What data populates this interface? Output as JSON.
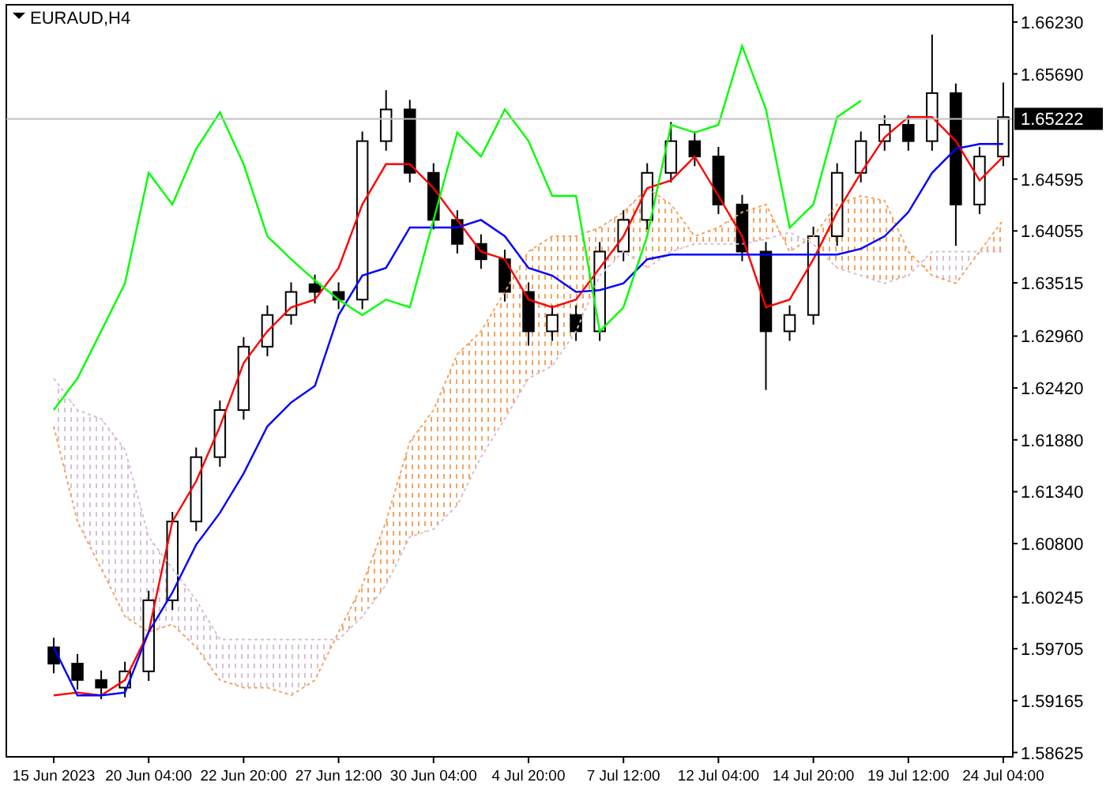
{
  "chart": {
    "title": "EURAUD,H4",
    "chart_data": {
      "type": "candlestick",
      "categories": [
        "15 Jun 2023",
        null,
        null,
        null,
        "20 Jun 04:00",
        null,
        null,
        null,
        "22 Jun 20:00",
        null,
        null,
        null,
        "27 Jun 12:00",
        null,
        null,
        null,
        "30 Jun 04:00",
        null,
        null,
        null,
        "4 Jul 20:00",
        null,
        null,
        null,
        "7 Jul 12:00",
        null,
        null,
        null,
        "12 Jul 04:00",
        null,
        null,
        null,
        "14 Jul 20:00",
        null,
        null,
        null,
        "19 Jul 12:00",
        null,
        null,
        null,
        "24 Jul 04:00"
      ],
      "ylim": [
        1.5858,
        1.6641
      ],
      "yticks": [
        {
          "value": 1.6623,
          "label": "1.66230"
        },
        {
          "value": 1.6569,
          "label": "1.65690"
        },
        {
          "value": 1.64595,
          "label": "1.64595"
        },
        {
          "value": 1.64055,
          "label": "1.64055"
        },
        {
          "value": 1.63515,
          "label": "1.63515"
        },
        {
          "value": 1.6296,
          "label": "1.62960"
        },
        {
          "value": 1.6242,
          "label": "1.62420"
        },
        {
          "value": 1.6188,
          "label": "1.61880"
        },
        {
          "value": 1.6134,
          "label": "1.61340"
        },
        {
          "value": 1.608,
          "label": "1.60800"
        },
        {
          "value": 1.60245,
          "label": "1.60245"
        },
        {
          "value": 1.59705,
          "label": "1.59705"
        },
        {
          "value": 1.59165,
          "label": "1.59165"
        },
        {
          "value": 1.58625,
          "label": "1.58625"
        }
      ],
      "ohlc": [
        [
          1.5972,
          1.5982,
          1.5945,
          1.5955
        ],
        [
          1.5955,
          1.5965,
          1.5928,
          1.5938
        ],
        [
          1.5938,
          1.5948,
          1.5918,
          1.593
        ],
        [
          1.593,
          1.5957,
          1.592,
          1.5947
        ],
        [
          1.5947,
          1.6031,
          1.5937,
          1.6021
        ],
        [
          1.6021,
          1.6113,
          1.6011,
          1.6103
        ],
        [
          1.6103,
          1.618,
          1.6093,
          1.617
        ],
        [
          1.617,
          1.6229,
          1.616,
          1.6219
        ],
        [
          1.6219,
          1.6295,
          1.6209,
          1.6285
        ],
        [
          1.6285,
          1.6328,
          1.6275,
          1.6318
        ],
        [
          1.6318,
          1.6352,
          1.6308,
          1.6342
        ],
        [
          1.635,
          1.636,
          1.633,
          1.6342
        ],
        [
          1.6342,
          1.6352,
          1.6324,
          1.6334
        ],
        [
          1.6334,
          1.6509,
          1.6324,
          1.6499
        ],
        [
          1.6499,
          1.6552,
          1.6489,
          1.6532
        ],
        [
          1.6532,
          1.6542,
          1.6456,
          1.6466
        ],
        [
          1.6466,
          1.6476,
          1.6407,
          1.6417
        ],
        [
          1.6417,
          1.6427,
          1.6382,
          1.6392
        ],
        [
          1.6392,
          1.6402,
          1.6366,
          1.6376
        ],
        [
          1.6376,
          1.6386,
          1.6332,
          1.6342
        ],
        [
          1.6342,
          1.6352,
          1.6286,
          1.6301
        ],
        [
          1.6301,
          1.6328,
          1.6291,
          1.6318
        ],
        [
          1.6318,
          1.6328,
          1.6291,
          1.6301
        ],
        [
          1.6301,
          1.6394,
          1.6291,
          1.6384
        ],
        [
          1.6384,
          1.6427,
          1.6374,
          1.6417
        ],
        [
          1.6417,
          1.6476,
          1.6407,
          1.6466
        ],
        [
          1.6466,
          1.6519,
          1.6456,
          1.6499
        ],
        [
          1.6499,
          1.6509,
          1.6473,
          1.6483
        ],
        [
          1.6483,
          1.6493,
          1.6423,
          1.6433
        ],
        [
          1.6433,
          1.6443,
          1.6374,
          1.6384
        ],
        [
          1.6384,
          1.6394,
          1.624,
          1.6301
        ],
        [
          1.6301,
          1.6328,
          1.6291,
          1.6318
        ],
        [
          1.6318,
          1.641,
          1.6308,
          1.64
        ],
        [
          1.64,
          1.6476,
          1.639,
          1.6466
        ],
        [
          1.6466,
          1.6509,
          1.6456,
          1.6499
        ],
        [
          1.6499,
          1.6526,
          1.6489,
          1.6516
        ],
        [
          1.6516,
          1.6526,
          1.6489,
          1.6499
        ],
        [
          1.6499,
          1.661,
          1.6489,
          1.6549
        ],
        [
          1.6549,
          1.6559,
          1.639,
          1.6433
        ],
        [
          1.6433,
          1.6493,
          1.6423,
          1.6483
        ],
        [
          1.6483,
          1.656,
          1.6473,
          1.6524
        ]
      ],
      "series": [
        {
          "type": "line",
          "line_style": "dashed",
          "color": "#f4a460",
          "values": [
            1.6202,
            1.6103,
            1.6054,
            1.6004,
            1.5988,
            1.5996,
            1.5972,
            1.5938,
            1.593,
            1.593,
            1.5922,
            1.5938,
            1.5988,
            1.6037,
            1.6103,
            1.6186,
            1.6219,
            1.6277,
            1.6301,
            1.6342,
            1.6384,
            1.64,
            1.64,
            1.6409,
            1.6425,
            1.645,
            1.6433,
            1.64,
            1.6409,
            1.6425,
            1.6433,
            1.6384,
            1.64,
            1.6433,
            1.6442,
            1.6437,
            1.6384,
            1.6359,
            1.6351,
            1.6384,
            1.6417
          ]
        },
        {
          "type": "line",
          "line_style": "dashed",
          "color": "#d8bfd8",
          "values": [
            1.6252,
            1.6219,
            1.621,
            1.6178,
            1.6087,
            1.6054,
            1.6021,
            1.598,
            1.598,
            1.598,
            1.598,
            1.598,
            1.598,
            1.6004,
            1.6037,
            1.6087,
            1.6095,
            1.612,
            1.617,
            1.621,
            1.6252,
            1.6265,
            1.6301,
            1.6359,
            1.6384,
            1.6367,
            1.6384,
            1.6392,
            1.6392,
            1.6392,
            1.6397,
            1.6404,
            1.6392,
            1.6367,
            1.6359,
            1.6351,
            1.6359,
            1.6384,
            1.6384,
            1.6384,
            1.6384
          ]
        },
        {
          "type": "line",
          "color": "#ff0000",
          "values": [
            1.5922,
            1.5925,
            1.5922,
            1.5938,
            1.5988,
            1.6103,
            1.6145,
            1.6202,
            1.6268,
            1.6301,
            1.6326,
            1.6334,
            1.6367,
            1.6433,
            1.6475,
            1.6475,
            1.645,
            1.6417,
            1.6384,
            1.6376,
            1.6334,
            1.6326,
            1.6334,
            1.6367,
            1.64,
            1.645,
            1.6458,
            1.6483,
            1.6442,
            1.64,
            1.6326,
            1.6334,
            1.6376,
            1.6425,
            1.6466,
            1.6503,
            1.6524,
            1.6524,
            1.6499,
            1.6458,
            1.6483
          ]
        },
        {
          "type": "line",
          "color": "#0000ff",
          "values": [
            1.5972,
            1.5922,
            1.5922,
            1.5925,
            1.5988,
            1.6029,
            1.6079,
            1.6112,
            1.6153,
            1.6202,
            1.6227,
            1.6244,
            1.6318,
            1.6359,
            1.6367,
            1.6409,
            1.6409,
            1.6409,
            1.6417,
            1.64,
            1.6367,
            1.6359,
            1.6342,
            1.6344,
            1.6351,
            1.6376,
            1.6381,
            1.6381,
            1.6381,
            1.6381,
            1.6381,
            1.6381,
            1.6381,
            1.6381,
            1.6387,
            1.64,
            1.6425,
            1.6466,
            1.6491,
            1.6496,
            1.6496
          ]
        },
        {
          "type": "line",
          "color": "#00ff00",
          "values": [
            1.6219,
            1.6252,
            1.6301,
            1.6351,
            1.6466,
            1.6433,
            1.6491,
            1.6529,
            1.6475,
            1.64,
            1.6376,
            1.6354,
            1.6334,
            1.6318,
            1.6334,
            1.6326,
            1.6417,
            1.6508,
            1.6483,
            1.6532,
            1.6499,
            1.6442,
            1.6442,
            1.6301,
            1.6326,
            1.64,
            1.6516,
            1.6508,
            1.6516,
            1.6598,
            1.6532,
            1.6409,
            1.6433,
            1.6524,
            1.6541,
            null,
            null,
            null,
            null,
            null,
            null
          ]
        }
      ],
      "ref_lines": [
        {
          "axis": "y",
          "value": 1.65222,
          "label": "1.65222"
        }
      ]
    }
  }
}
